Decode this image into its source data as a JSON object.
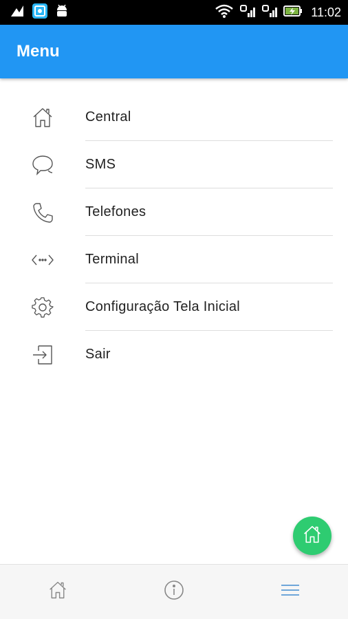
{
  "status_bar": {
    "time": "11:02",
    "icons": [
      "notification-icon",
      "app-icon",
      "android-icon",
      "wifi-icon",
      "signal-icon",
      "signal-icon-2",
      "battery-charging-icon"
    ]
  },
  "app_bar": {
    "title": "Menu"
  },
  "menu": {
    "items": [
      {
        "label": "Central",
        "icon": "home-icon"
      },
      {
        "label": "SMS",
        "icon": "chat-icon"
      },
      {
        "label": "Telefones",
        "icon": "phone-icon"
      },
      {
        "label": "Terminal",
        "icon": "code-icon"
      },
      {
        "label": "Configuração Tela Inicial",
        "icon": "gear-icon"
      },
      {
        "label": "Sair",
        "icon": "exit-icon"
      }
    ]
  },
  "fab": {
    "icon": "home-icon",
    "color": "#2ecc71"
  },
  "bottom_nav": {
    "items": [
      {
        "icon": "home-icon",
        "active": false
      },
      {
        "icon": "info-icon",
        "active": false
      },
      {
        "icon": "menu-icon",
        "active": true
      }
    ]
  },
  "colors": {
    "primary": "#2196f3",
    "accent": "#2ecc71",
    "nav_active": "#5b9bd5",
    "nav_inactive": "#888888"
  }
}
